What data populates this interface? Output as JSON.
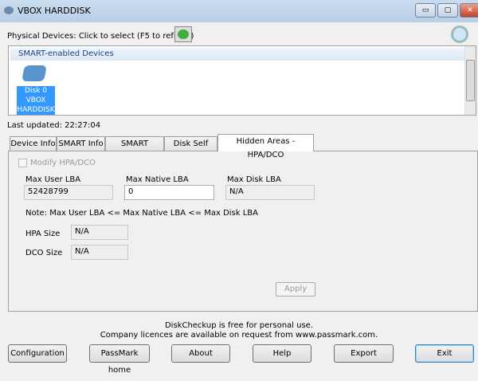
{
  "window": {
    "title": "VBOX HARDDISK",
    "minimize": "▭",
    "maximize": "▢",
    "close": "✕"
  },
  "devices": {
    "label": "Physical Devices: Click to select (F5 to refresh)",
    "group_header": "SMART-enabled Devices",
    "disk": [
      "Disk 0",
      "VBOX",
      "HARDDISK"
    ]
  },
  "last_updated": "Last updated: 22:27:04",
  "tabs": [
    "Device Info",
    "SMART Info",
    "SMART History",
    "Disk Self Test",
    "Hidden Areas - HPA/DCO"
  ],
  "hpa": {
    "modify_label": "Modify HPA/DCO",
    "max_user_lba_label": "Max User LBA",
    "max_user_lba": "52428799",
    "max_native_lba_label": "Max Native LBA",
    "max_native_lba": "0",
    "max_disk_lba_label": "Max Disk LBA",
    "max_disk_lba": "N/A",
    "note": "Note: Max User LBA  <= Max Native LBA  <= Max Disk LBA",
    "hpa_size_label": "HPA Size",
    "hpa_size": "N/A",
    "dco_size_label": "DCO Size",
    "dco_size": "N/A",
    "apply": "Apply"
  },
  "footer": {
    "line1": "DiskCheckup is free for personal use.",
    "line2": "Company licences are available on request from www.passmark.com."
  },
  "buttons": {
    "configuration": "Configuration",
    "passmark_home": "PassMark home",
    "about": "About",
    "help": "Help",
    "export": "Export",
    "exit": "Exit"
  }
}
